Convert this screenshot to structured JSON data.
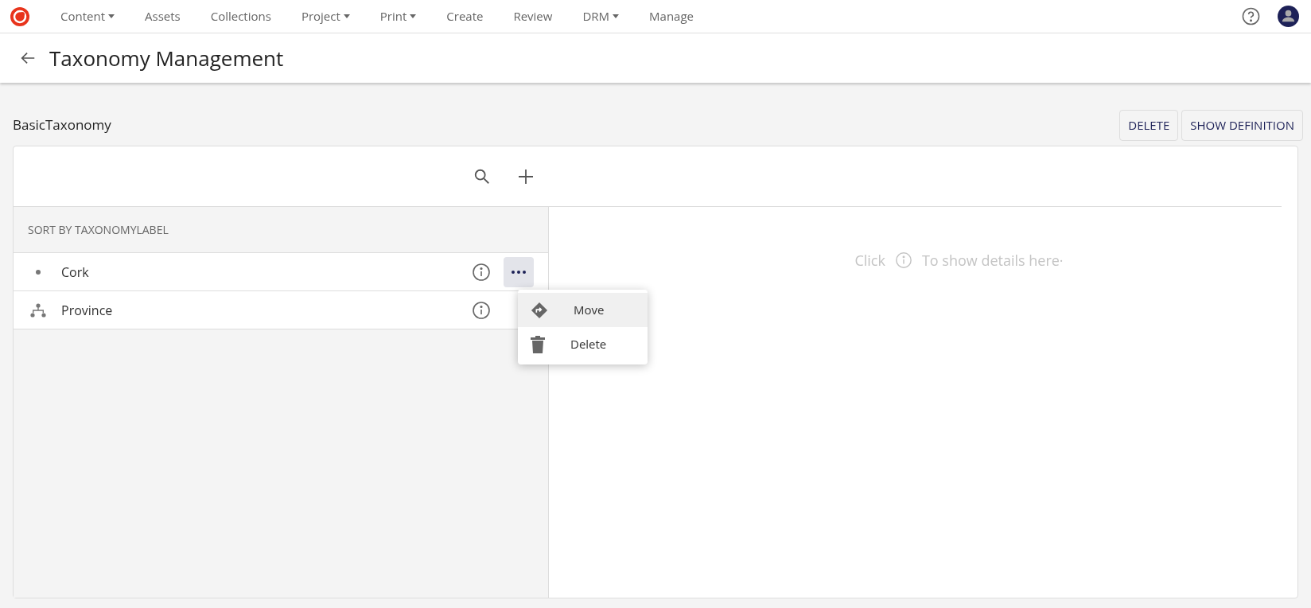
{
  "nav": {
    "items": [
      {
        "label": "Content",
        "dropdown": true
      },
      {
        "label": "Assets",
        "dropdown": false
      },
      {
        "label": "Collections",
        "dropdown": false
      },
      {
        "label": "Project",
        "dropdown": true
      },
      {
        "label": "Print",
        "dropdown": true
      },
      {
        "label": "Create",
        "dropdown": false
      },
      {
        "label": "Review",
        "dropdown": false
      },
      {
        "label": "DRM",
        "dropdown": true
      },
      {
        "label": "Manage",
        "dropdown": false
      }
    ]
  },
  "page": {
    "title": "Taxonomy Management"
  },
  "taxonomy": {
    "name": "BasicTaxonomy",
    "buttons": [
      "DELETE",
      "SHOW DEFINITION"
    ]
  },
  "tree": {
    "sort_label": "SORT BY TAXONOMYLABEL",
    "items": [
      {
        "label": "Cork",
        "kind": "leaf",
        "menu_open": true
      },
      {
        "label": "Province",
        "kind": "branch",
        "menu_open": false
      }
    ]
  },
  "menu": {
    "items": [
      {
        "label": "Move",
        "kind": "move",
        "hovered": true
      },
      {
        "label": "Delete",
        "kind": "delete",
        "hovered": false
      }
    ]
  },
  "details": {
    "hint_before": "Click",
    "hint_after": "To show details here·"
  }
}
